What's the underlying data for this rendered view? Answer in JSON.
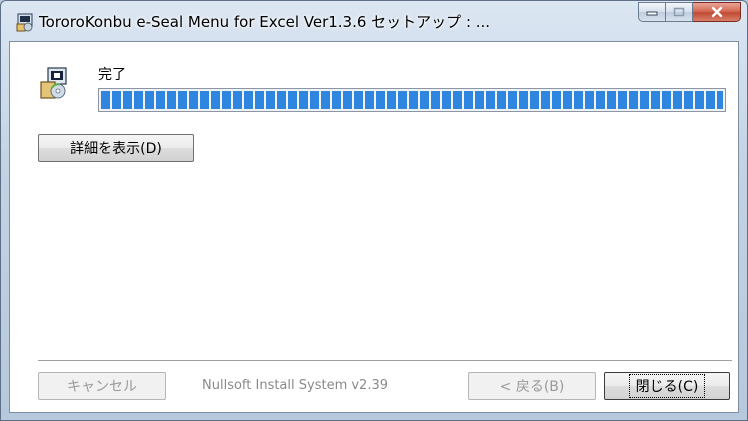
{
  "window": {
    "title": "TororoKonbu e-Seal Menu for Excel Ver1.3.6 セットアップ : ...",
    "minimize_icon": "minimize-icon",
    "maximize_icon": "maximize-icon",
    "close_icon": "close-icon"
  },
  "status": {
    "text": "完了",
    "progress": 1.0,
    "progress_color": "#2e86e0"
  },
  "buttons": {
    "show_details": "詳細を表示(D)",
    "cancel": "キャンセル",
    "back": "< 戻る(B)",
    "close": "閉じる(C)"
  },
  "footer": {
    "branding": "Nullsoft Install System v2.39"
  }
}
